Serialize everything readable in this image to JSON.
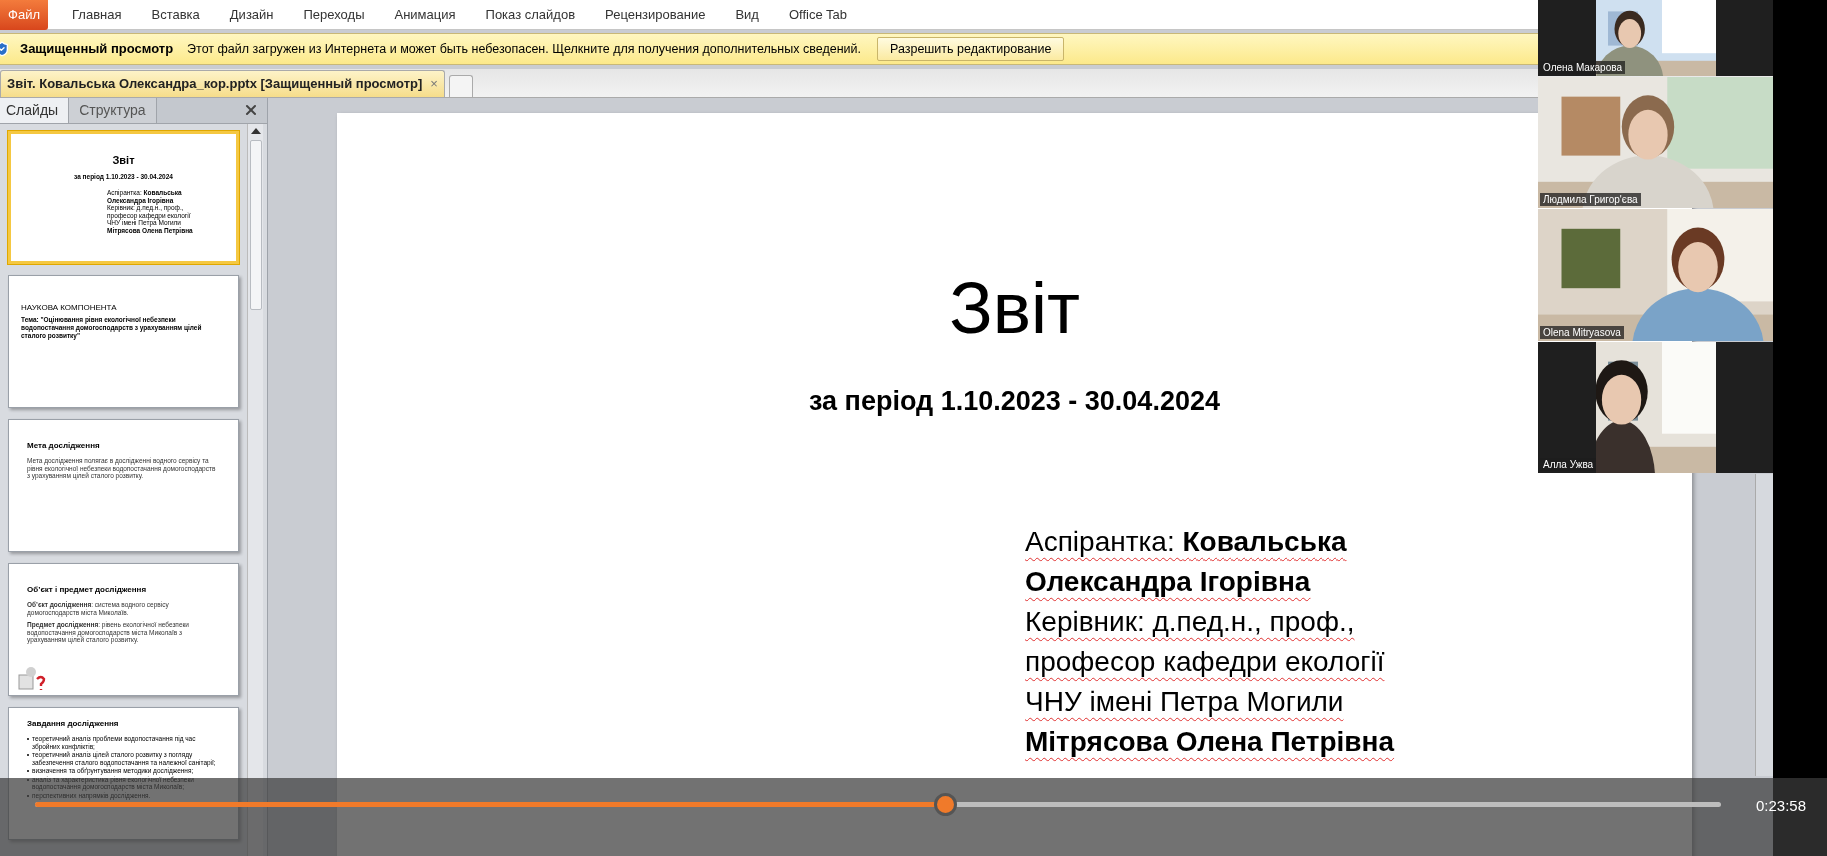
{
  "ribbon": {
    "tabs": [
      {
        "label": "Файл",
        "kind": "file"
      },
      {
        "label": "Главная",
        "kind": "tab"
      },
      {
        "label": "Вставка",
        "kind": "tab"
      },
      {
        "label": "Дизайн",
        "kind": "tab"
      },
      {
        "label": "Переходы",
        "kind": "tab"
      },
      {
        "label": "Анимация",
        "kind": "tab"
      },
      {
        "label": "Показ слайдов",
        "kind": "tab"
      },
      {
        "label": "Рецензирование",
        "kind": "tab"
      },
      {
        "label": "Вид",
        "kind": "tab"
      },
      {
        "label": "Office Tab",
        "kind": "tab"
      }
    ]
  },
  "protected_view": {
    "title": "Защищенный просмотр",
    "message": "Этот файл загружен из Интернета и может быть небезопасен. Щелкните для получения дополнительных сведений.",
    "button": "Разрешить редактирование"
  },
  "document_tabs": [
    {
      "label": "Звіт. Ковальська Олександра_кор.pptx [Защищенный просмотр]",
      "close": "×",
      "selected": true
    }
  ],
  "slides_panel": {
    "tabs": [
      {
        "label": "Слайды",
        "selected": true
      },
      {
        "label": "Структура",
        "selected": false
      }
    ],
    "thumbnails": [
      {
        "kind": "title",
        "selected": true,
        "title": "Звіт",
        "subtitle": "за період 1.10.2023 - 30.04.2024",
        "lines": [
          "Аспірантка: **Ковальська**",
          "**Олександра Ігорівна**",
          "Керівник: д.пед.н., проф.,",
          "професор кафедри екології",
          "ЧНУ імені Петра Могили",
          "**Мітрясова Олена Петрівна**"
        ]
      },
      {
        "kind": "topic",
        "selected": false,
        "heading": "НАУКОВА КОМПОНЕНТА",
        "body": "Тема: \"Оцінювання рівня екологічної небезпеки водопостачання домогосподарств з урахуванням цілей сталого розвитку\""
      },
      {
        "kind": "text",
        "selected": false,
        "heading": "Мета дослідження",
        "paragraphs": [
          "Мета дослідження полягає в дослідженні водного сервісу та рівня екологічної небезпеки водопостачання домогосподарств з урахуванням цілей сталого розвитку."
        ]
      },
      {
        "kind": "text",
        "selected": false,
        "heading": "Об’єкт і предмет дослідження",
        "paragraphs": [
          "**Об’єкт дослідження**: система водного сервісу домогосподарств міста Миколаїв.",
          "**Предмет дослідження**: рівень екологічної небезпеки водопостачання домогосподарств міста Миколаїв з урахуванням цілей сталого розвитку."
        ],
        "figure": true
      },
      {
        "kind": "bullets",
        "selected": false,
        "heading": "Завдання дослідження",
        "bullets": [
          "теоретичний аналіз проблеми водопостачання під час збройних конфліктів;",
          "теоретичний аналіз цілей сталого розвитку з погляду забезпечення сталого водопостачання та належної санітарії;",
          "визначення та обґрунтування методики дослідження;",
          "аналіз та характеристика рівня екологічної небезпеки водопостачання домогосподарств міста Миколаїв;",
          "перспективних напрямків дослідження."
        ]
      }
    ]
  },
  "slide": {
    "title": "Звіт",
    "subtitle": "за період 1.10.2023 - 30.04.2024",
    "lines": [
      "Аспірантка: **Ковальська**",
      "**Олександра Ігорівна**",
      "Керівник: д.пед.н., проф.,",
      "професор кафедри екології",
      "ЧНУ імені Петра Могили",
      "**Мітрясова Олена Петрівна**"
    ]
  },
  "video_tiles": [
    {
      "name": "Олена Макарова",
      "kind": "narrow"
    },
    {
      "name": "Людмила Григор'єва",
      "kind": "wide"
    },
    {
      "name": "Olena Mitryasova",
      "kind": "wide"
    },
    {
      "name": "Алла Ужва",
      "kind": "narrow"
    }
  ],
  "player": {
    "level": 0.54,
    "time": "0:23:58"
  }
}
